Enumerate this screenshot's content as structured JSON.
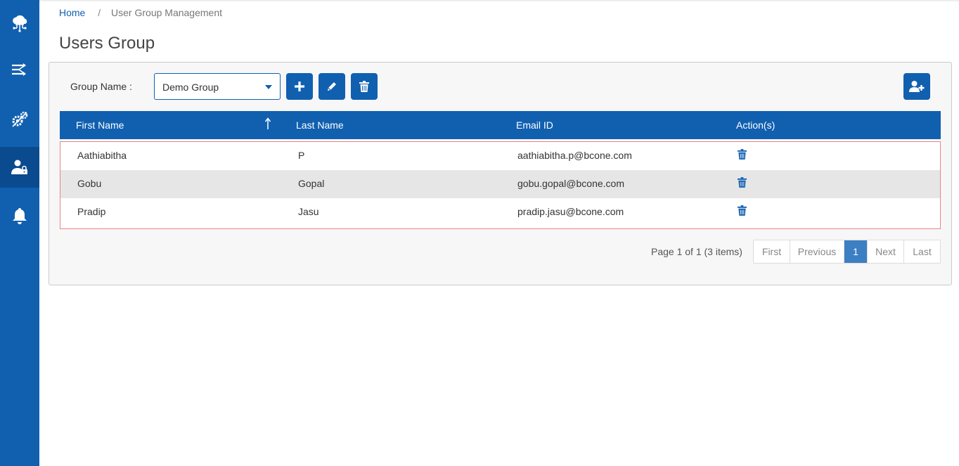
{
  "sidebar": {
    "items": [
      {
        "icon": "cloud-network-icon",
        "active": false
      },
      {
        "icon": "transfer-arrows-icon",
        "active": false
      },
      {
        "icon": "settings-gears-icon",
        "active": false
      },
      {
        "icon": "user-lock-icon",
        "active": true
      },
      {
        "icon": "bell-icon",
        "active": false
      }
    ]
  },
  "breadcrumb": {
    "home": "Home",
    "separator": "/",
    "current": "User Group Management"
  },
  "page": {
    "title": "Users Group"
  },
  "toolbar": {
    "group_label": "Group Name :",
    "selected_group": "Demo Group",
    "add_icon": "plus-icon",
    "edit_icon": "pencil-icon",
    "delete_icon": "trash-icon",
    "add_user_icon": "user-plus-icon"
  },
  "table": {
    "columns": [
      "First Name",
      "Last Name",
      "Email ID",
      "Action(s)"
    ],
    "sort": {
      "column": "First Name",
      "direction": "ascending"
    },
    "rows": [
      {
        "first_name": "Aathiabitha",
        "last_name": "P",
        "email": "aathiabitha.p@bcone.com"
      },
      {
        "first_name": "Gobu",
        "last_name": "Gopal",
        "email": "gobu.gopal@bcone.com"
      },
      {
        "first_name": "Pradip",
        "last_name": "Jasu",
        "email": "pradip.jasu@bcone.com"
      }
    ]
  },
  "pagination": {
    "info": "Page 1 of 1 (3 items)",
    "first": "First",
    "previous": "Previous",
    "current": "1",
    "next": "Next",
    "last": "Last"
  },
  "colors": {
    "primary": "#1160b0",
    "sidebar_active": "#0a4a8e",
    "row_alt": "#e6e6e6",
    "table_border": "#e8838a"
  }
}
